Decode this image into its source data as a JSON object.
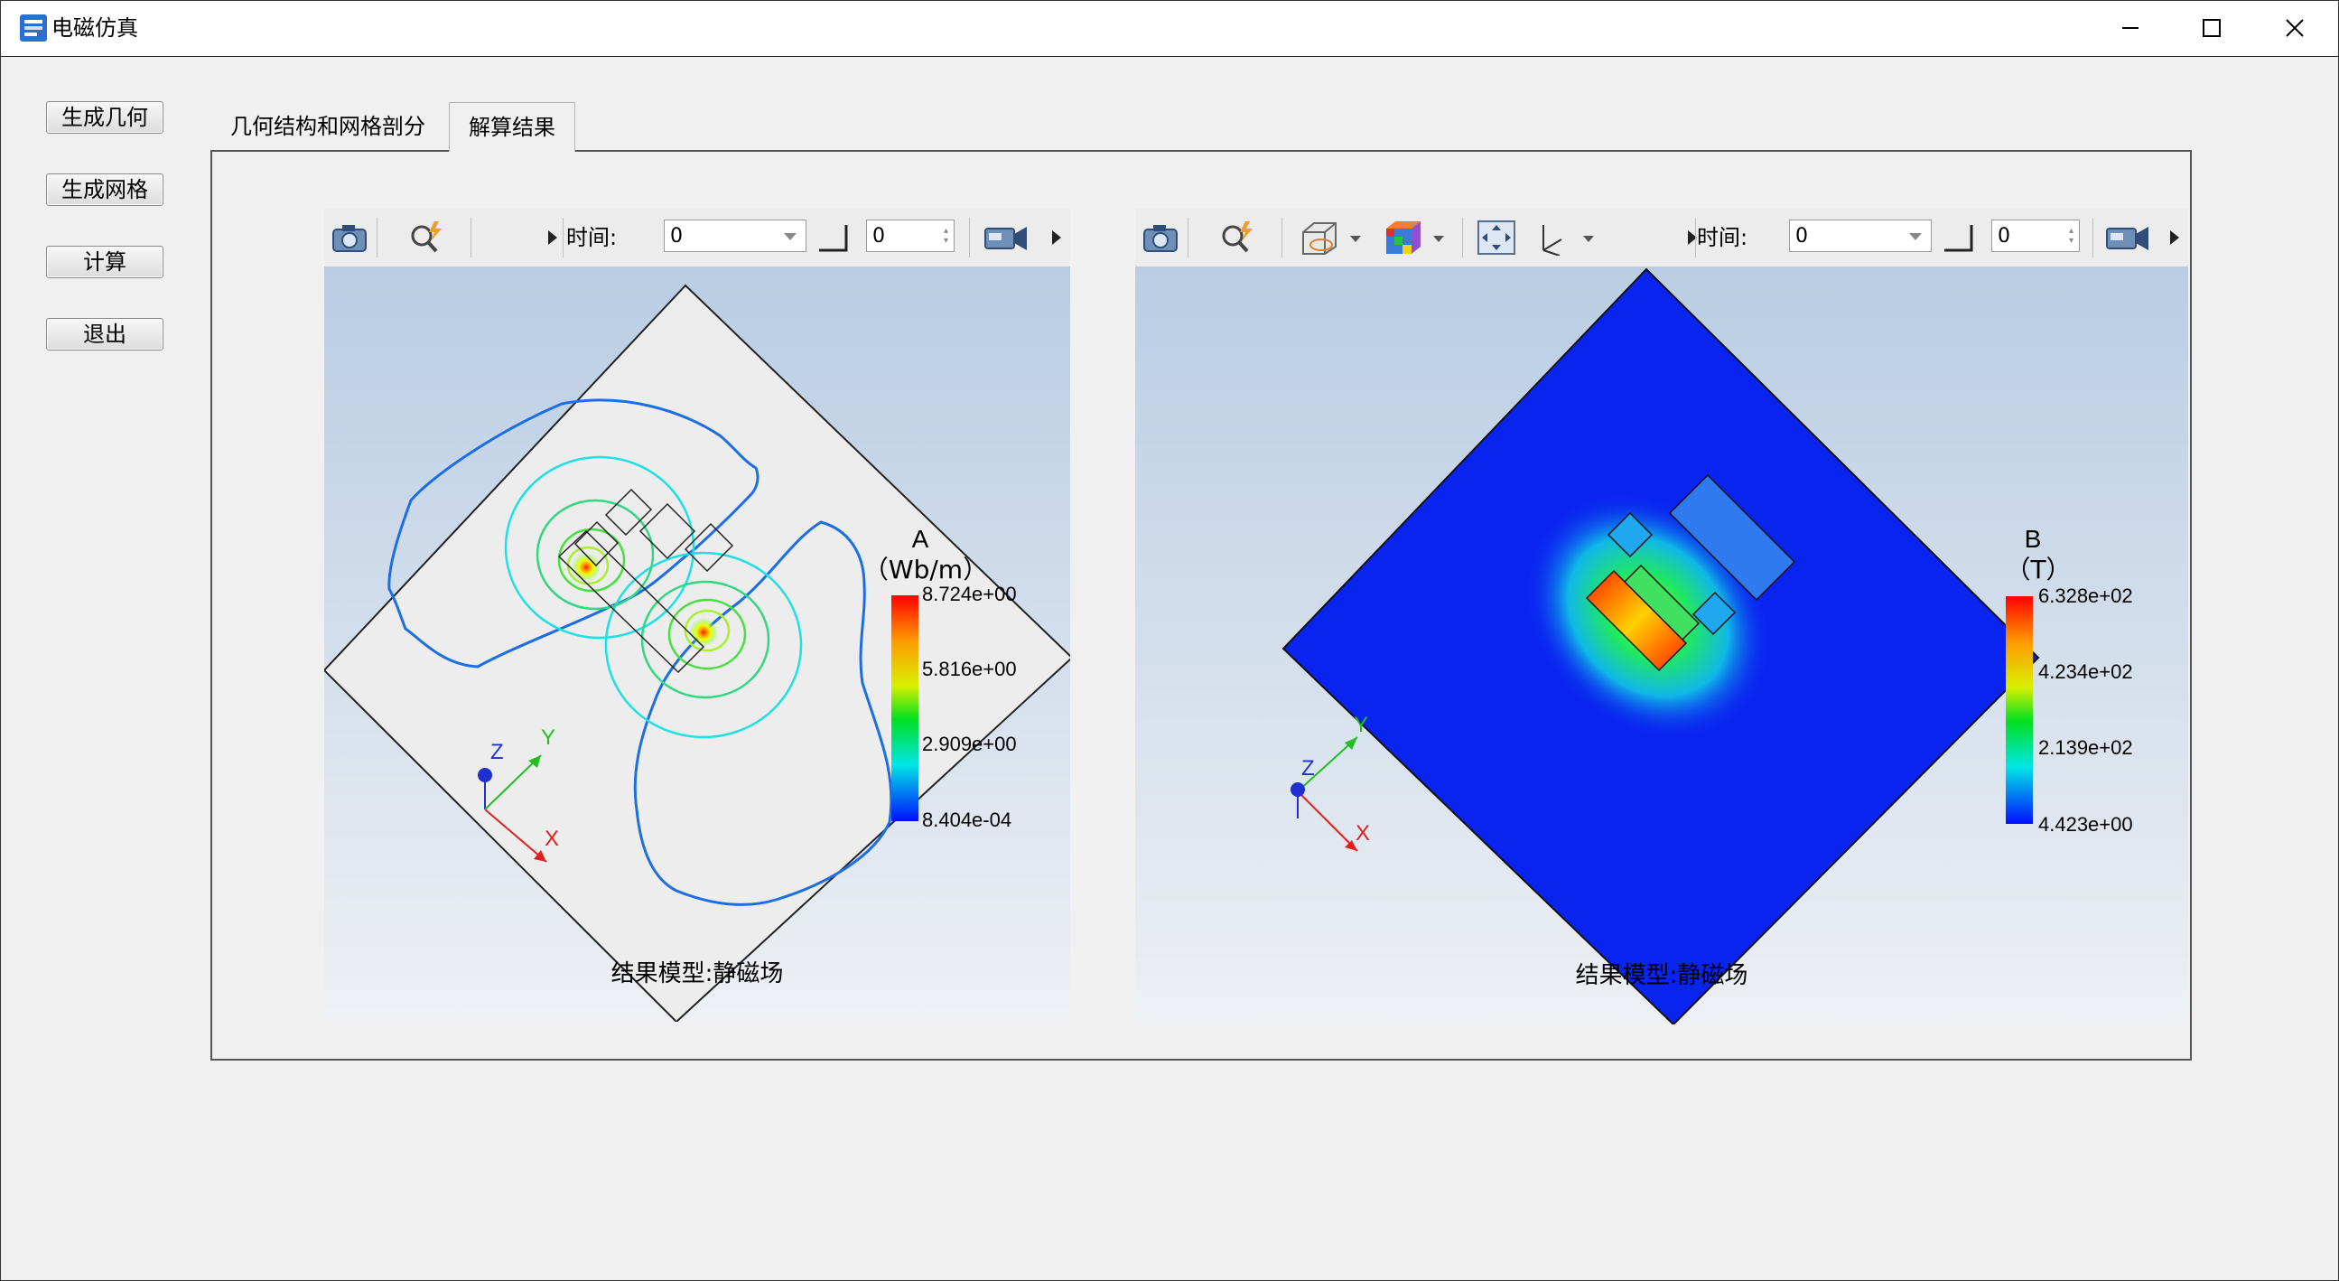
{
  "window": {
    "title": "电磁仿真"
  },
  "sidebar": {
    "buttons": [
      {
        "label": "生成几何"
      },
      {
        "label": "生成网格"
      },
      {
        "label": "计算"
      },
      {
        "label": "退出"
      }
    ]
  },
  "tabs": [
    {
      "label": "几何结构和网格剖分",
      "active": false
    },
    {
      "label": "解算结果",
      "active": true
    }
  ],
  "viewers": [
    {
      "toolbar": {
        "time_label": "时间:",
        "time_value": "0",
        "step_value": "0",
        "icons": [
          "camera-icon",
          "zoom-icon",
          "video-camera-icon"
        ]
      },
      "legend": {
        "title": "A",
        "unit": "（Wb/m）",
        "ticks": [
          "8.724e+00",
          "5.816e+00",
          "2.909e+00",
          "8.404e-04"
        ]
      },
      "caption": "结果模型:静磁场",
      "axes": {
        "x": "X",
        "y": "Y",
        "z": "Z"
      }
    },
    {
      "toolbar": {
        "time_label": "时间:",
        "time_value": "0",
        "step_value": "0",
        "icons": [
          "camera-icon",
          "zoom-icon",
          "cube-view-icon",
          "color-cube-icon",
          "fit-view-icon",
          "axes-icon",
          "video-camera-icon"
        ]
      },
      "legend": {
        "title": "B",
        "unit": "（T）",
        "ticks": [
          "6.328e+02",
          "4.234e+02",
          "2.139e+02",
          "4.423e+00"
        ]
      },
      "caption": "结果模型:静磁场",
      "axes": {
        "x": "X",
        "y": "Y",
        "z": "Z"
      }
    }
  ],
  "colors": {
    "contour_blue": "#1c6ee6",
    "contour_cyan": "#1ee0e6",
    "contour_green": "#3ddc3a",
    "field_blue": "#0a24f0",
    "viewport_top": "#b9cde4",
    "viewport_bottom": "#eef0f4"
  }
}
